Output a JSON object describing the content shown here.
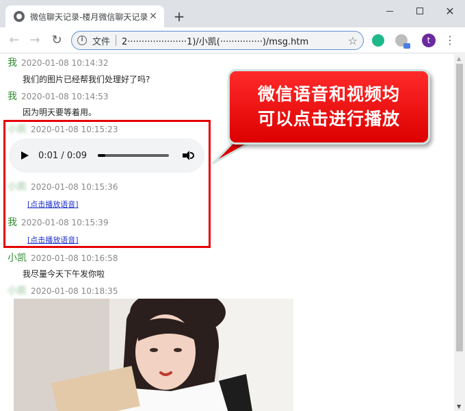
{
  "browser": {
    "tab_title": "微信聊天记录-楼月微信聊天记录",
    "tab_close": "✕",
    "new_tab": "+",
    "scheme_label": "文件",
    "url": "2·····················1)/小凯(···············)/msg.htm",
    "avatar_letter": "t",
    "menu": "⋮",
    "back": "←",
    "forward": "→",
    "reload": "↻",
    "star": "☆",
    "info": "i"
  },
  "messages": [
    {
      "sender": "我",
      "time": "2020-01-08 10:14:32",
      "text": "我们的图片已经帮我们处理好了吗?"
    },
    {
      "sender": "我",
      "time": "2020-01-08 10:14:53",
      "text": "因为明天要等着用。"
    },
    {
      "sender": "小凯",
      "time": "2020-01-08 10:15:23"
    },
    {
      "sender": "小凯",
      "time": "2020-01-08 10:15:36",
      "link": "[点击播放语音]"
    },
    {
      "sender": "我",
      "time": "2020-01-08 10:15:39",
      "link": "[点击播放语音]"
    },
    {
      "sender": "小凯",
      "time": "2020-01-08 10:16:58",
      "text": "我尽量今天下午发你啦"
    },
    {
      "sender": "小凯",
      "time": "2020-01-08 10:18:35"
    }
  ],
  "audio": {
    "time": "0:01 / 0:09",
    "progress": 0.11
  },
  "callout": {
    "line1": "微信语音和视频均",
    "line2": "可以点击进行播放"
  },
  "colors": {
    "sender_green": "#2e8b2e",
    "highlight_red": "#e50000",
    "callout_red": "#ee1111",
    "link_blue": "#2233cc"
  }
}
